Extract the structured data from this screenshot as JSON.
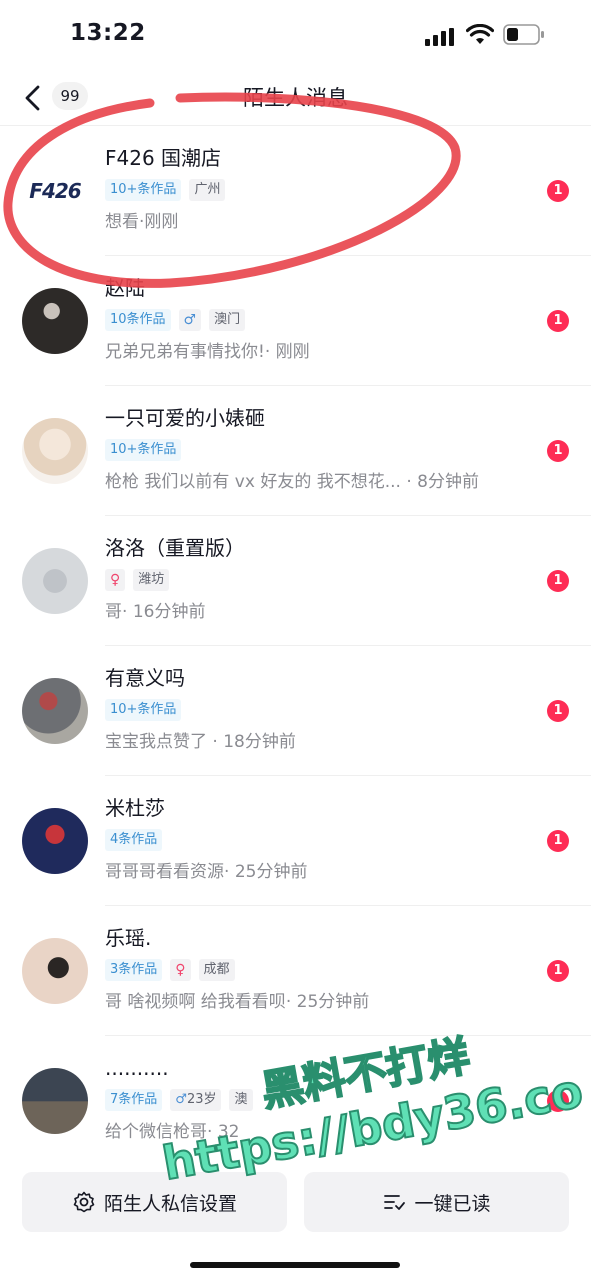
{
  "status_bar": {
    "time": "13:22"
  },
  "header": {
    "title": "陌生人消息",
    "back_count": "99"
  },
  "messages": [
    {
      "name": "F426 国潮店",
      "avatar_text": "F426",
      "works": "10+条作品",
      "gender": "",
      "age": "",
      "location": "广州",
      "preview": "想看",
      "time": "刚刚",
      "unread": "1"
    },
    {
      "name": "赵陆",
      "avatar_text": "",
      "works": "10条作品",
      "gender": "♂",
      "age": "",
      "location": "澳门",
      "preview": "兄弟兄弟有事情找你!",
      "time": "刚刚",
      "unread": "1"
    },
    {
      "name": "一只可爱的小婊砸",
      "avatar_text": "",
      "works": "10+条作品",
      "gender": "",
      "age": "",
      "location": "",
      "preview": "枪枪 我们以前有 vx 好友的 我不想花...",
      "time": "8分钟前",
      "unread": "1"
    },
    {
      "name": "洛洛（重置版）",
      "avatar_text": "",
      "works": "",
      "gender": "♀",
      "age": "",
      "location": "潍坊",
      "preview": "哥",
      "time": "16分钟前",
      "unread": "1"
    },
    {
      "name": "有意义吗",
      "avatar_text": "",
      "works": "10+条作品",
      "gender": "",
      "age": "",
      "location": "",
      "preview": "宝宝我点赞了",
      "time": "18分钟前",
      "unread": "1"
    },
    {
      "name": "米杜莎",
      "avatar_text": "",
      "works": "4条作品",
      "gender": "",
      "age": "",
      "location": "",
      "preview": "哥哥哥看看资源",
      "time": "25分钟前",
      "unread": "1"
    },
    {
      "name": "乐瑶.",
      "avatar_text": "",
      "works": "3条作品",
      "gender": "♀",
      "age": "",
      "location": "成都",
      "preview": "哥 啥视频啊 给我看看呗",
      "time": "25分钟前",
      "unread": "1"
    },
    {
      "name": "..........",
      "avatar_text": "",
      "works": "7条作品",
      "gender": "♂",
      "age": "23岁",
      "location": "澳",
      "preview": "给个微信枪哥",
      "time": "32",
      "unread": "1"
    }
  ],
  "bottom": {
    "settings_label": "陌生人私信设置",
    "mark_read_label": "一键已读"
  },
  "watermark": {
    "line1": "黑料不打烊",
    "line2": "https://bdy36.co"
  },
  "colors": {
    "unread": "#fe2c55",
    "works_tag": "#3a8fd0",
    "annotation": "#e8424a",
    "watermark": "#5fe0b5"
  }
}
